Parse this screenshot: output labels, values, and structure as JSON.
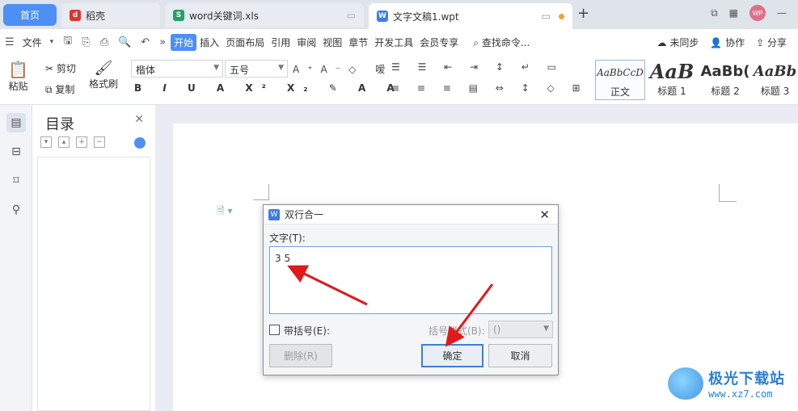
{
  "tabs": {
    "home": "首页",
    "daoke": "稻壳",
    "xls": "word关键词.xls",
    "wpt": "文字文稿1.wpt"
  },
  "menu": {
    "file": "文件",
    "items": [
      "开始",
      "插入",
      "页面布局",
      "引用",
      "审阅",
      "视图",
      "章节",
      "开发工具",
      "会员专享"
    ],
    "search": "查找命令...",
    "sync": "未同步",
    "collab": "协作",
    "share": "分享"
  },
  "ribbon": {
    "paste": "粘贴",
    "cut": "剪切",
    "copy": "复制",
    "format_painter": "格式刷",
    "font_name": "楷体",
    "font_size": "五号",
    "styles": [
      {
        "preview": "AaBbCcD",
        "name": "正文"
      },
      {
        "preview": "AaB",
        "name": "标题 1"
      },
      {
        "preview": "AaBb(",
        "name": "标题 2"
      },
      {
        "preview": "AaBb",
        "name": "标题 3"
      }
    ]
  },
  "toc": {
    "title": "目录"
  },
  "dialog": {
    "title": "双行合一",
    "text_label": "文字(T):",
    "text_value": "3 5",
    "bracket_label": "带括号(E):",
    "bracket_style_label": "括号样式(B):",
    "bracket_style_value": "()",
    "delete_label": "删除(R)",
    "ok_label": "确定",
    "cancel_label": "取消"
  },
  "watermark": {
    "name": "极光下载站",
    "url": "www.xz7.com"
  },
  "colors": {
    "accent": "#4e8ff4",
    "arrow": "#e0191b"
  }
}
